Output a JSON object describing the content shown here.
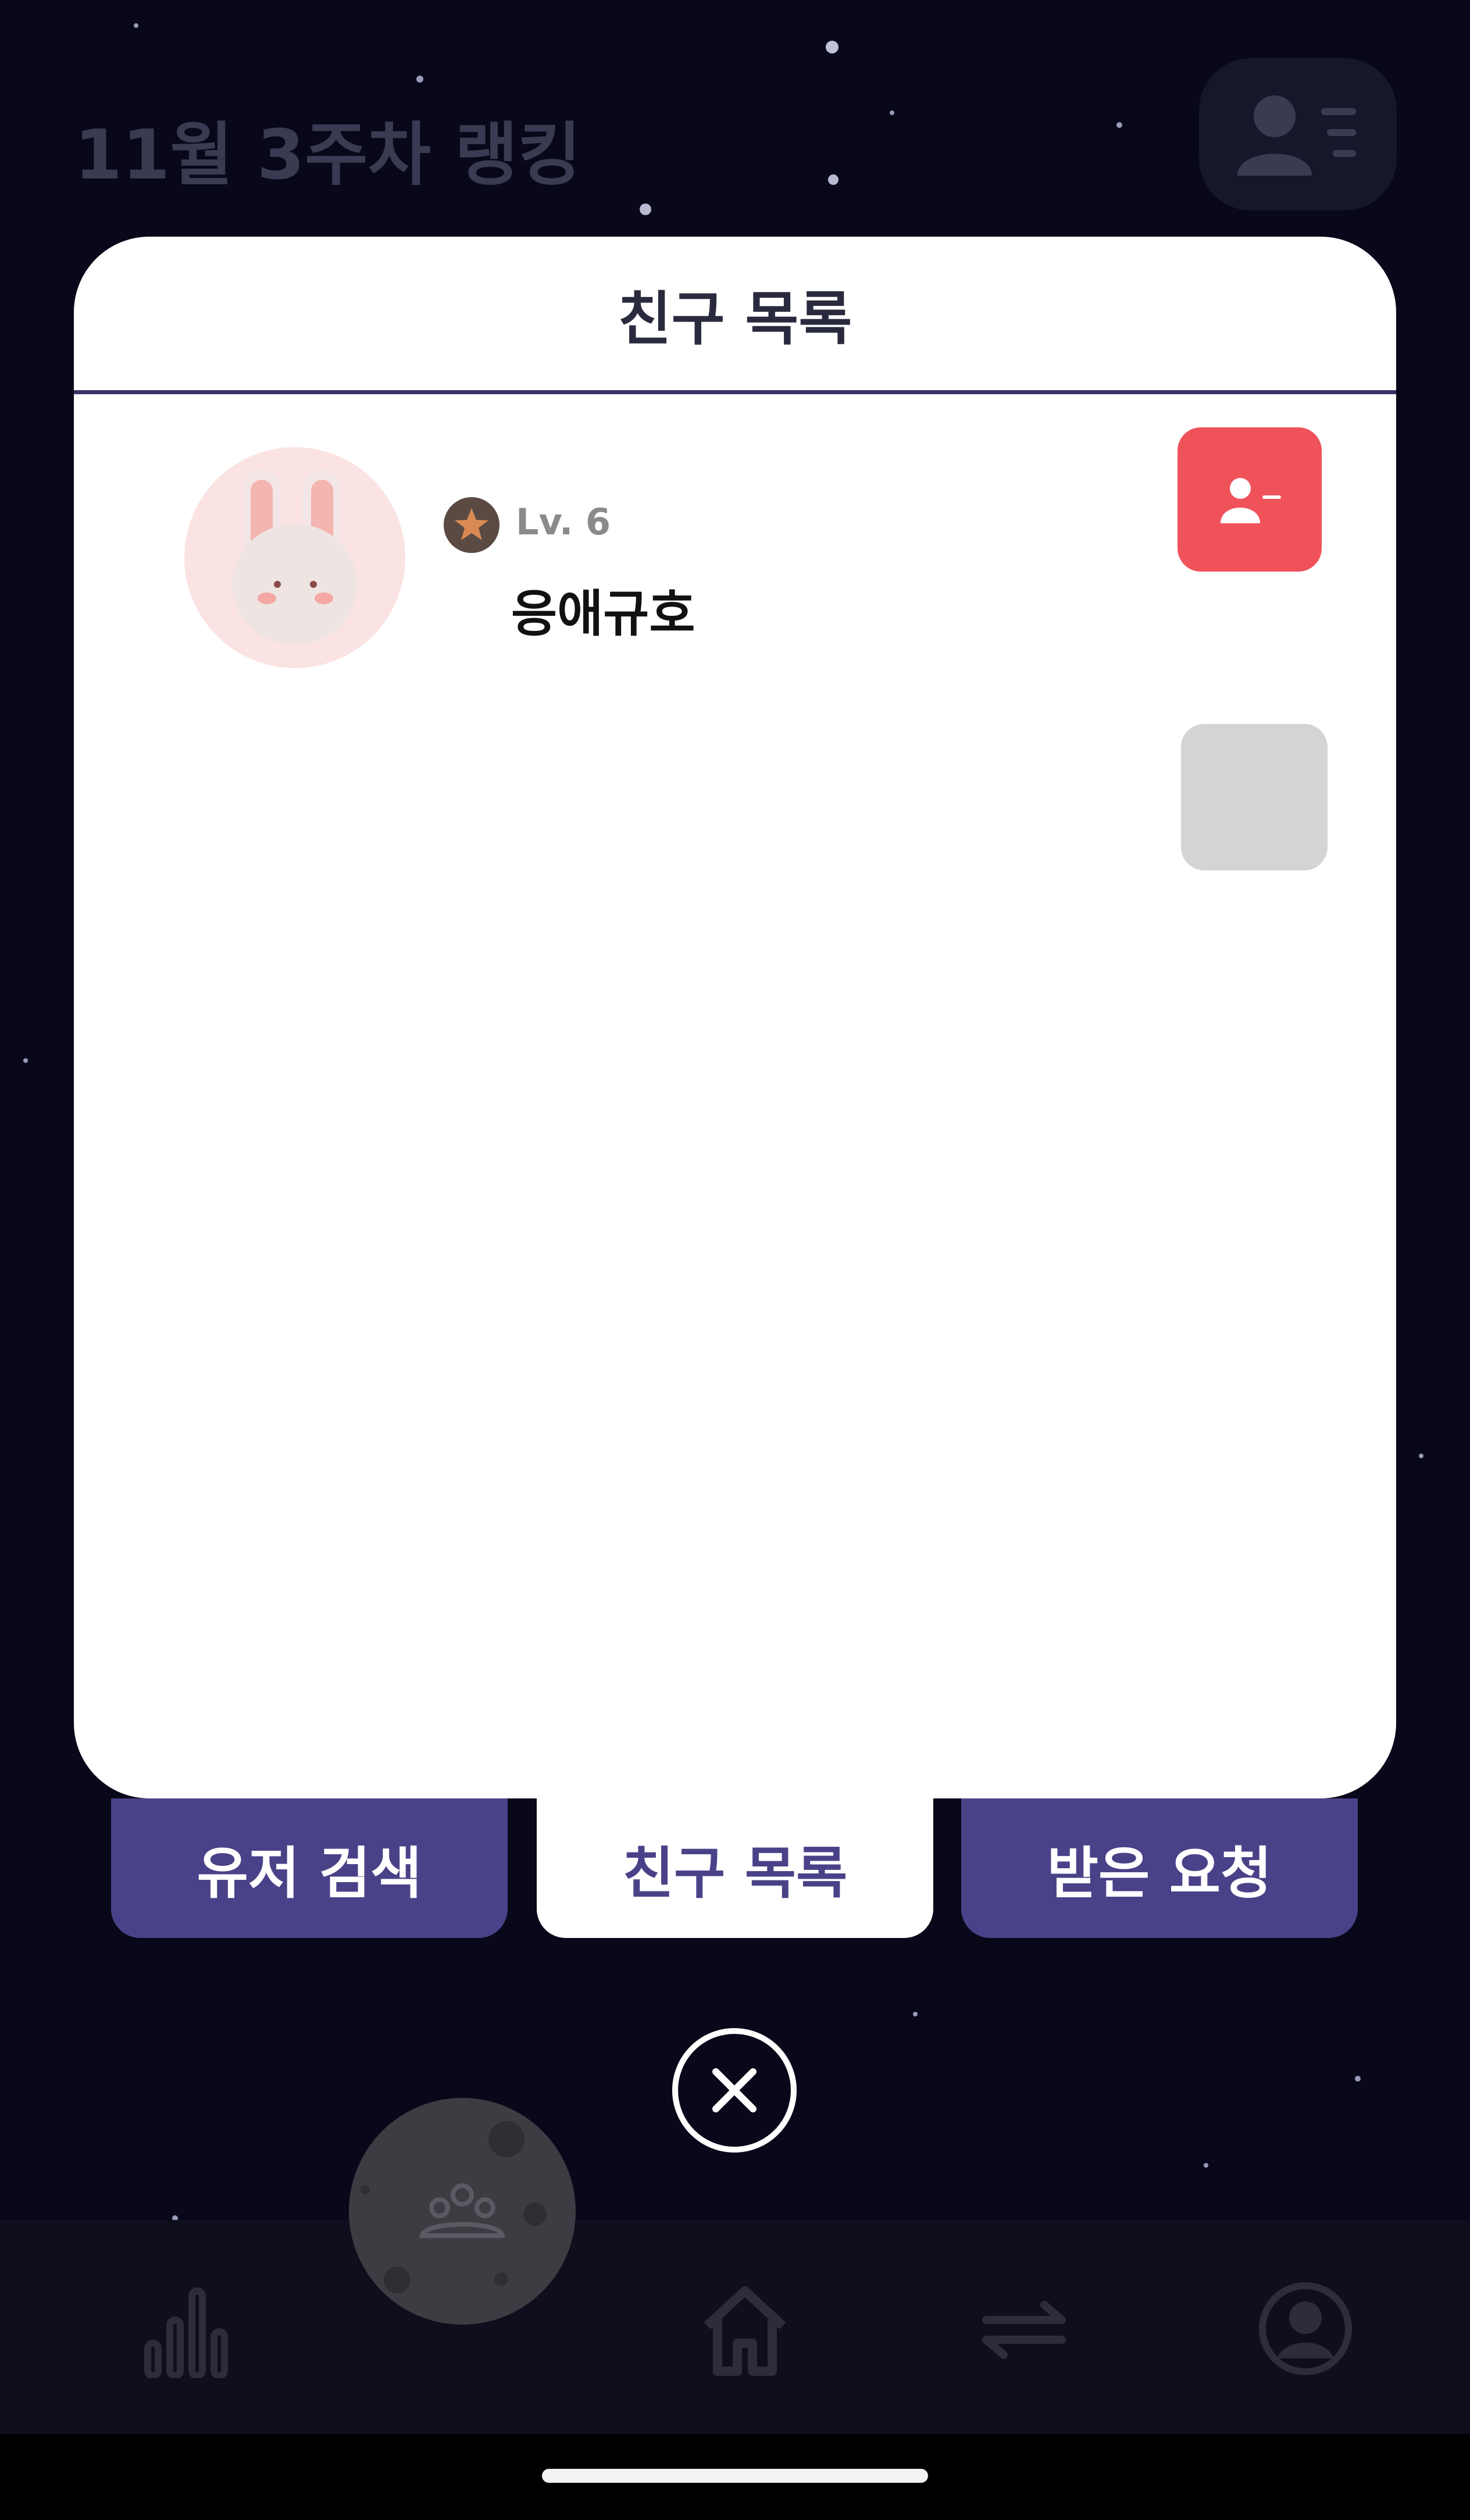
{
  "background": {
    "ranking_title": "11월 3주차 랭킹",
    "top_button_icon": "user-list-icon"
  },
  "modal": {
    "title": "친구 목록",
    "friends": [
      {
        "avatar_icon": "bunny-avatar-icon",
        "level_icon": "bronze-star-badge-icon",
        "level": "Lv. 6",
        "name": "응애규호",
        "action_icon": "user-remove-icon"
      }
    ]
  },
  "tabs": [
    {
      "label": "유저 검색",
      "active": false
    },
    {
      "label": "친구 목록",
      "active": true
    },
    {
      "label": "받은 요청",
      "active": false
    }
  ],
  "close_icon": "close-icon",
  "bottom_nav": {
    "items": [
      {
        "icon": "bar-chart-icon"
      },
      {
        "icon": "moon-friends-icon"
      },
      {
        "icon": "home-icon"
      },
      {
        "icon": "swap-arrows-icon"
      },
      {
        "icon": "profile-icon"
      }
    ]
  },
  "colors": {
    "accent": "#4a4288",
    "remove": "#f0525a",
    "divider": "#3b3467",
    "background": "#08081a"
  }
}
